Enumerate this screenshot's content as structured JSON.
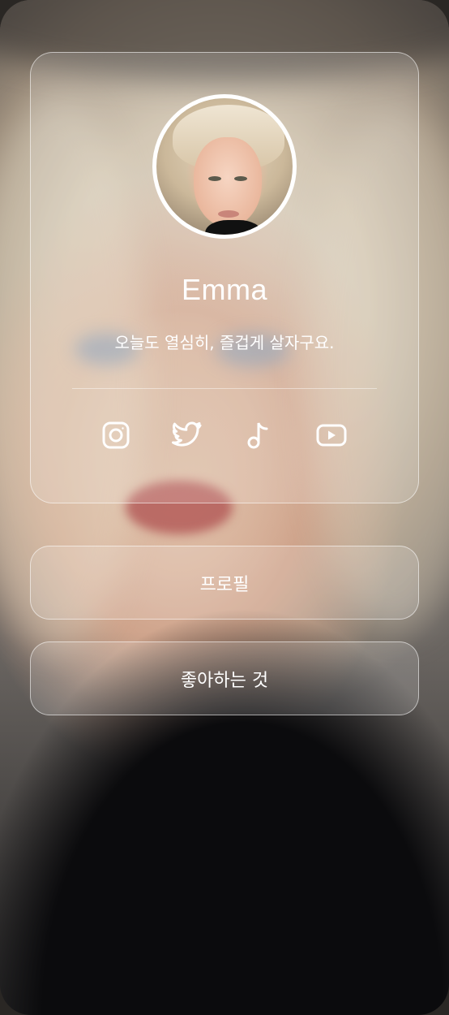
{
  "profile": {
    "name": "Emma",
    "bio": "오늘도 열심히, 즐겁게 살자구요."
  },
  "social_links": [
    {
      "icon": "instagram-icon"
    },
    {
      "icon": "twitter-icon"
    },
    {
      "icon": "tiktok-icon"
    },
    {
      "icon": "youtube-icon"
    }
  ],
  "menu": {
    "profile_label": "프로필",
    "likes_label": "좋아하는 것"
  },
  "colors": {
    "text": "#ffffff",
    "card_border": "#ffffffcc"
  }
}
